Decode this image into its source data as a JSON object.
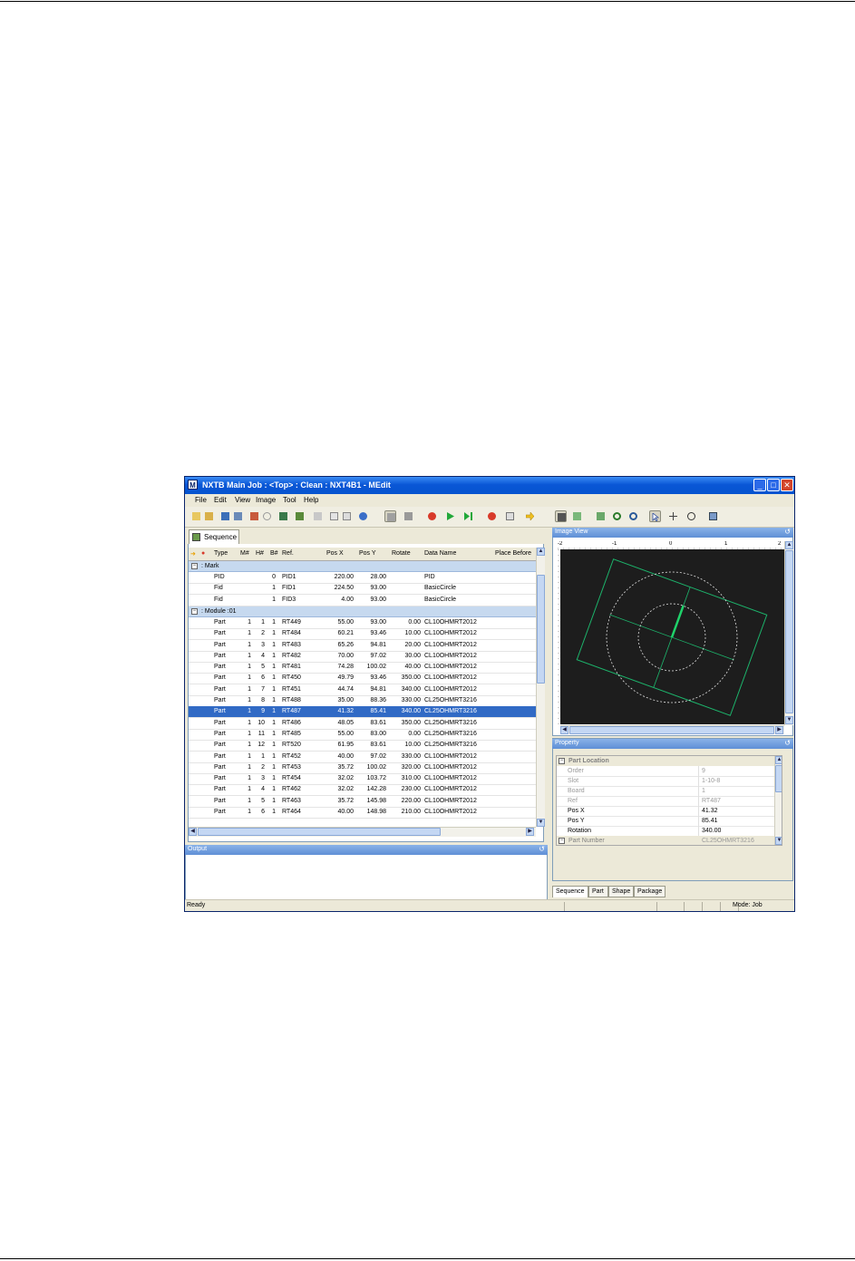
{
  "window": {
    "title": "NXTB Main Job : <Top> : Clean : NXT4B1 - MEdit",
    "app_icon": "M",
    "controls": [
      "_",
      "□",
      "✕"
    ]
  },
  "menu": [
    "File",
    "Edit",
    "View",
    "Image",
    "Tool",
    "Help"
  ],
  "sequence_panel": {
    "tab_label": "Sequence",
    "columns": [
      "Type",
      "M#",
      "H#",
      "B#",
      "Ref.",
      "Pos X",
      "Pos Y",
      "Rotate",
      "Data Name",
      "Place Before"
    ],
    "groups": [
      {
        "label": ": Mark",
        "rows": [
          {
            "type": "PID",
            "m": "",
            "h": "",
            "b": "0",
            "ref": "PID1",
            "x": "220.00",
            "y": "28.00",
            "rot": "",
            "data": "PID"
          },
          {
            "type": "Fid",
            "m": "",
            "h": "",
            "b": "1",
            "ref": "FID1",
            "x": "224.50",
            "y": "93.00",
            "rot": "",
            "data": "BasicCircle"
          },
          {
            "type": "Fid",
            "m": "",
            "h": "",
            "b": "1",
            "ref": "FID3",
            "x": "4.00",
            "y": "93.00",
            "rot": "",
            "data": "BasicCircle"
          }
        ]
      },
      {
        "label": ": Module :01",
        "rows": [
          {
            "type": "Part",
            "m": "1",
            "h": "1",
            "b": "1",
            "ref": "RT449",
            "x": "55.00",
            "y": "93.00",
            "rot": "0.00",
            "data": "CL10OHMRT2012"
          },
          {
            "type": "Part",
            "m": "1",
            "h": "2",
            "b": "1",
            "ref": "RT484",
            "x": "60.21",
            "y": "93.46",
            "rot": "10.00",
            "data": "CL10OHMRT2012"
          },
          {
            "type": "Part",
            "m": "1",
            "h": "3",
            "b": "1",
            "ref": "RT483",
            "x": "65.26",
            "y": "94.81",
            "rot": "20.00",
            "data": "CL10OHMRT2012"
          },
          {
            "type": "Part",
            "m": "1",
            "h": "4",
            "b": "1",
            "ref": "RT482",
            "x": "70.00",
            "y": "97.02",
            "rot": "30.00",
            "data": "CL10OHMRT2012"
          },
          {
            "type": "Part",
            "m": "1",
            "h": "5",
            "b": "1",
            "ref": "RT481",
            "x": "74.28",
            "y": "100.02",
            "rot": "40.00",
            "data": "CL10OHMRT2012"
          },
          {
            "type": "Part",
            "m": "1",
            "h": "6",
            "b": "1",
            "ref": "RT450",
            "x": "49.79",
            "y": "93.46",
            "rot": "350.00",
            "data": "CL10OHMRT2012"
          },
          {
            "type": "Part",
            "m": "1",
            "h": "7",
            "b": "1",
            "ref": "RT451",
            "x": "44.74",
            "y": "94.81",
            "rot": "340.00",
            "data": "CL10OHMRT2012"
          },
          {
            "type": "Part",
            "m": "1",
            "h": "8",
            "b": "1",
            "ref": "RT488",
            "x": "35.00",
            "y": "88.36",
            "rot": "330.00",
            "data": "CL25OHMRT3216"
          },
          {
            "type": "Part",
            "m": "1",
            "h": "9",
            "b": "1",
            "ref": "RT487",
            "x": "41.32",
            "y": "85.41",
            "rot": "340.00",
            "data": "CL25OHMRT3216",
            "selected": true
          },
          {
            "type": "Part",
            "m": "1",
            "h": "10",
            "b": "1",
            "ref": "RT486",
            "x": "48.05",
            "y": "83.61",
            "rot": "350.00",
            "data": "CL25OHMRT3216"
          },
          {
            "type": "Part",
            "m": "1",
            "h": "11",
            "b": "1",
            "ref": "RT485",
            "x": "55.00",
            "y": "83.00",
            "rot": "0.00",
            "data": "CL25OHMRT3216"
          },
          {
            "type": "Part",
            "m": "1",
            "h": "12",
            "b": "1",
            "ref": "RT520",
            "x": "61.95",
            "y": "83.61",
            "rot": "10.00",
            "data": "CL25OHMRT3216"
          },
          {
            "type": "Part",
            "m": "1",
            "h": "1",
            "b": "1",
            "ref": "RT452",
            "x": "40.00",
            "y": "97.02",
            "rot": "330.00",
            "data": "CL10OHMRT2012"
          },
          {
            "type": "Part",
            "m": "1",
            "h": "2",
            "b": "1",
            "ref": "RT453",
            "x": "35.72",
            "y": "100.02",
            "rot": "320.00",
            "data": "CL10OHMRT2012"
          },
          {
            "type": "Part",
            "m": "1",
            "h": "3",
            "b": "1",
            "ref": "RT454",
            "x": "32.02",
            "y": "103.72",
            "rot": "310.00",
            "data": "CL10OHMRT2012"
          },
          {
            "type": "Part",
            "m": "1",
            "h": "4",
            "b": "1",
            "ref": "RT462",
            "x": "32.02",
            "y": "142.28",
            "rot": "230.00",
            "data": "CL10OHMRT2012"
          },
          {
            "type": "Part",
            "m": "1",
            "h": "5",
            "b": "1",
            "ref": "RT463",
            "x": "35.72",
            "y": "145.98",
            "rot": "220.00",
            "data": "CL10OHMRT2012"
          },
          {
            "type": "Part",
            "m": "1",
            "h": "6",
            "b": "1",
            "ref": "RT464",
            "x": "40.00",
            "y": "148.98",
            "rot": "210.00",
            "data": "CL10OHMRT2012"
          }
        ]
      }
    ]
  },
  "output_panel": {
    "title": "Output"
  },
  "image_view": {
    "title": "Image View",
    "ruler_labels": [
      "-2",
      "-1",
      "0",
      "1",
      "2"
    ],
    "colors": {
      "background": "#1d1d1d",
      "outline": "#1db36b",
      "circle": "#e0e0e0",
      "part": "#1fd26a"
    }
  },
  "property_panel": {
    "title": "Property",
    "category": "Part Location",
    "rows": [
      {
        "key": "Order",
        "value": "9",
        "dim": true
      },
      {
        "key": "Slot",
        "value": "1-10-8",
        "dim": true
      },
      {
        "key": "Board",
        "value": "1",
        "dim": true
      },
      {
        "key": "Ref",
        "value": "RT487",
        "dim": true
      },
      {
        "key": "Pos X",
        "value": "41.32",
        "dim": false
      },
      {
        "key": "Pos Y",
        "value": "85.41",
        "dim": false
      },
      {
        "key": "Rotation",
        "value": "340.00",
        "dim": false
      }
    ],
    "category2": "Part Number",
    "category2_value": "CL25OHMRT3216",
    "tabs": [
      "Sequence",
      "Part",
      "Shape",
      "Package"
    ]
  },
  "status": {
    "left": "Ready",
    "mode": "Mode: Job"
  }
}
